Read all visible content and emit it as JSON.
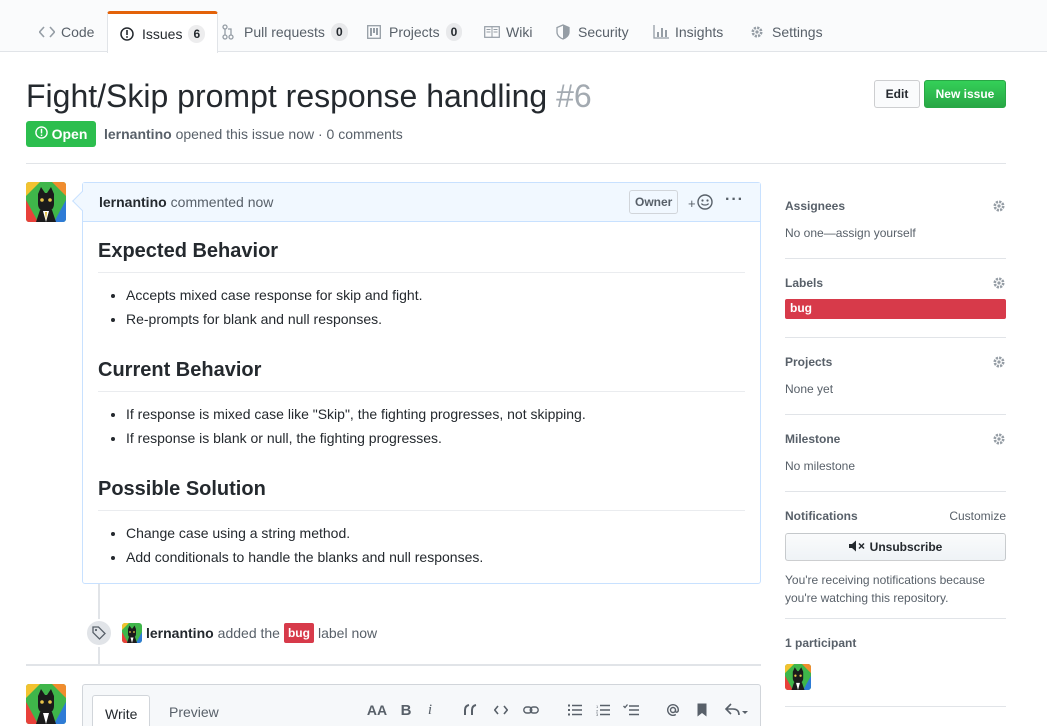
{
  "tabs": [
    {
      "label": "Code",
      "icon": "code-icon",
      "counter": null
    },
    {
      "label": "Issues",
      "icon": "issue-opened-icon",
      "counter": "6"
    },
    {
      "label": "Pull requests",
      "icon": "git-pull-request-icon",
      "counter": "0"
    },
    {
      "label": "Projects",
      "icon": "project-icon",
      "counter": "0"
    },
    {
      "label": "Wiki",
      "icon": "book-icon",
      "counter": null
    },
    {
      "label": "Security",
      "icon": "shield-icon",
      "counter": null
    },
    {
      "label": "Insights",
      "icon": "graph-icon",
      "counter": null
    },
    {
      "label": "Settings",
      "icon": "gear-icon",
      "counter": null
    }
  ],
  "issue": {
    "title": "Fight/Skip prompt response handling",
    "number": "#6",
    "state": "Open",
    "author": "lernantino",
    "meta_rest": "opened this issue now · 0 comments",
    "edit_label": "Edit",
    "new_issue_label": "New issue"
  },
  "comment": {
    "author": "lernantino",
    "time": "commented now",
    "owner_badge": "Owner",
    "reaction_plus": "+",
    "more": "···",
    "sections": [
      {
        "heading": "Expected Behavior",
        "items": [
          "Accepts mixed case response for skip and fight.",
          "Re-prompts for blank and null responses."
        ]
      },
      {
        "heading": "Current Behavior",
        "items": [
          "If response is mixed case like \"Skip\", the fighting progresses, not skipping.",
          "If response is blank or null, the fighting progresses."
        ]
      },
      {
        "heading": "Possible Solution",
        "items": [
          "Change case using a string method.",
          "Add conditionals to handle the blanks and null responses."
        ]
      }
    ]
  },
  "event": {
    "actor": "lernantino",
    "pre": "added the",
    "label": "bug",
    "post": "label now"
  },
  "new_comment": {
    "write_tab": "Write",
    "preview_tab": "Preview",
    "toolbar": {
      "header": "AA",
      "bold": "B",
      "italic": "i"
    }
  },
  "sidebar": {
    "assignees": {
      "title": "Assignees",
      "value": "No one—assign yourself"
    },
    "labels": {
      "title": "Labels",
      "value": "bug"
    },
    "projects": {
      "title": "Projects",
      "value": "None yet"
    },
    "milestone": {
      "title": "Milestone",
      "value": "No milestone"
    },
    "notifications": {
      "title": "Notifications",
      "customize": "Customize",
      "button": "Unsubscribe",
      "note": "You're receiving notifications because you're watching this repository."
    },
    "participants": {
      "title": "1 participant"
    }
  },
  "colors": {
    "open_green": "#2cbe4e",
    "bug_red": "#d73a4a",
    "tab_accent": "#e36209",
    "comment_border": "#c8e1ff"
  }
}
